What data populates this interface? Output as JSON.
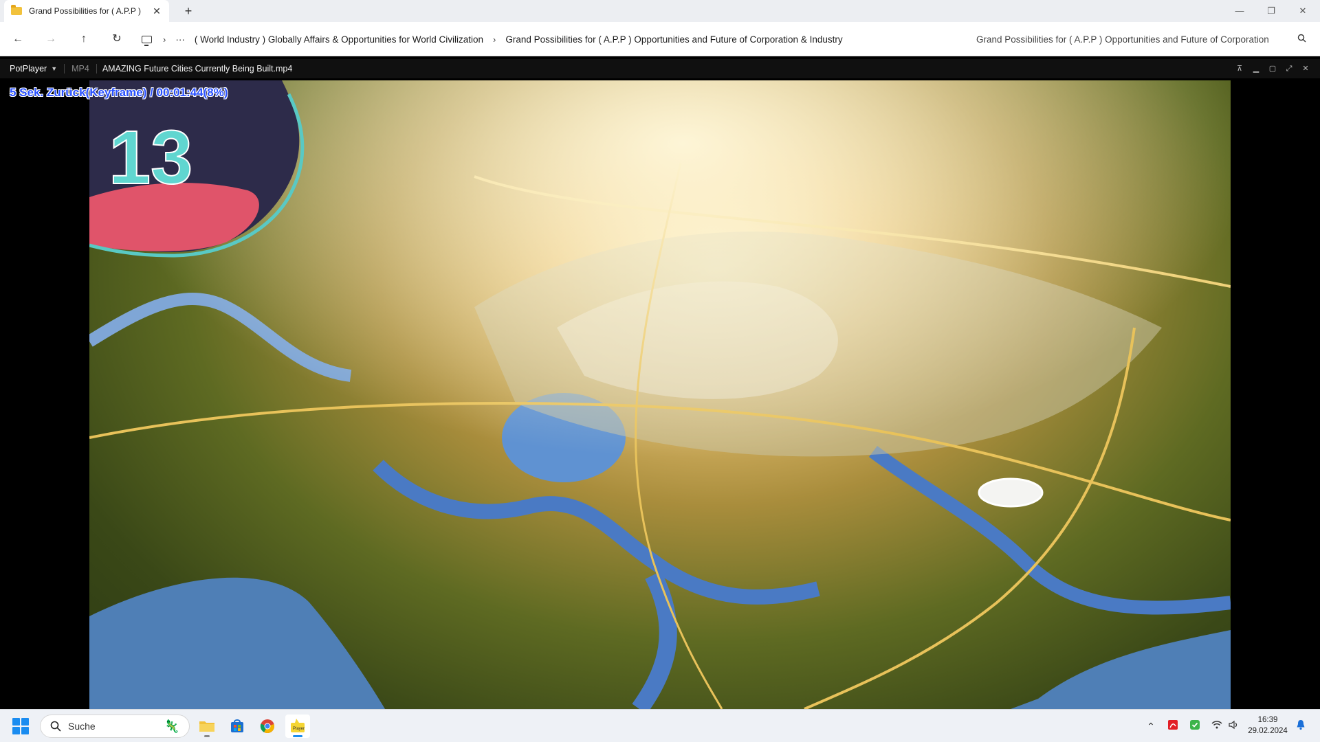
{
  "explorer": {
    "tab_title": "Grand Possibilities for ( A.P.P )",
    "tab_close_glyph": "✕",
    "new_tab_glyph": "+",
    "window_controls": {
      "minimize": "—",
      "restore": "❐",
      "close": "✕"
    },
    "nav": {
      "back": "←",
      "forward": "→",
      "up": "↑",
      "refresh": "↻"
    },
    "breadcrumb_overflow": "···",
    "breadcrumbs": [
      "( World Industry ) Globally Affairs & Opportunities for World Civilization",
      "Grand Possibilities for ( A.P.P ) Opportunities and Future of Corporation & Industry"
    ],
    "search_placeholder": "Grand Possibilities for ( A.P.P ) Opportunities and Future of Corporation"
  },
  "player": {
    "app_name": "PotPlayer",
    "format": "MP4",
    "file_name": "AMAZING Future Cities Currently Being Built.mp4",
    "osd_message": "5  Sek. Zurück(Keyframe) / 00:01:44(8%)",
    "video_badge_number": "13",
    "controls": {
      "pin": "⊼",
      "minimize": "▁",
      "maximize": "▢",
      "fullscreen": "⤢",
      "close": "✕"
    }
  },
  "taskbar": {
    "search_label": "Suche",
    "apps": [
      "file-explorer",
      "microsoft-store",
      "chrome",
      "potplayer"
    ],
    "clock_time": "16:39",
    "clock_date": "29.02.2024"
  },
  "colors": {
    "osd_text": "#2850ff",
    "windows_accent": "#1a8cf0"
  }
}
